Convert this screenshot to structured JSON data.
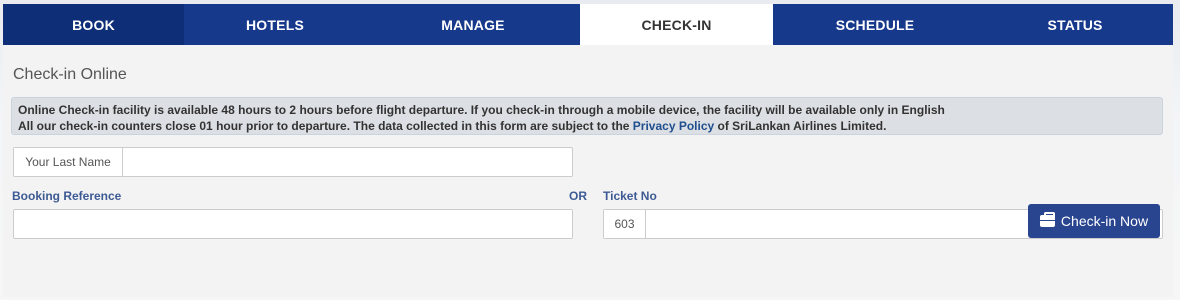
{
  "nav": {
    "tabs": [
      {
        "label": "BOOK"
      },
      {
        "label": "HOTELS"
      },
      {
        "label": "MANAGE"
      },
      {
        "label": "CHECK-IN"
      },
      {
        "label": "SCHEDULE"
      },
      {
        "label": "STATUS"
      }
    ],
    "active_tab": "CHECK-IN"
  },
  "page": {
    "title": "Check-in Online"
  },
  "notice": {
    "line1_prefix": "Online Check-in facility is available 48 ",
    "line1_hours": "hours",
    "line1_suffix": " to 2 hours before flight departure. If you check-in through a mobile device, the facility will be available only in English",
    "line2_prefix": "All our check-in counters close 01 hour prior to departure. The data collected in this form are subject to the ",
    "line2_link": "Privacy Policy",
    "line2_suffix": " of SriLankan Airlines Limited."
  },
  "form": {
    "last_name_addon": "Your Last Name",
    "last_name_value": "",
    "booking_reference_label": "Booking Reference",
    "booking_reference_value": "",
    "or_label": "OR",
    "ticket_no_label": "Ticket No",
    "ticket_prefix": "603",
    "ticket_value": "",
    "submit_label": "Check-in Now"
  },
  "colors": {
    "nav_bg": "#17398c",
    "active_tab_bg": "#ffffff",
    "button_bg": "#29458f",
    "label_color": "#3d5a94"
  }
}
